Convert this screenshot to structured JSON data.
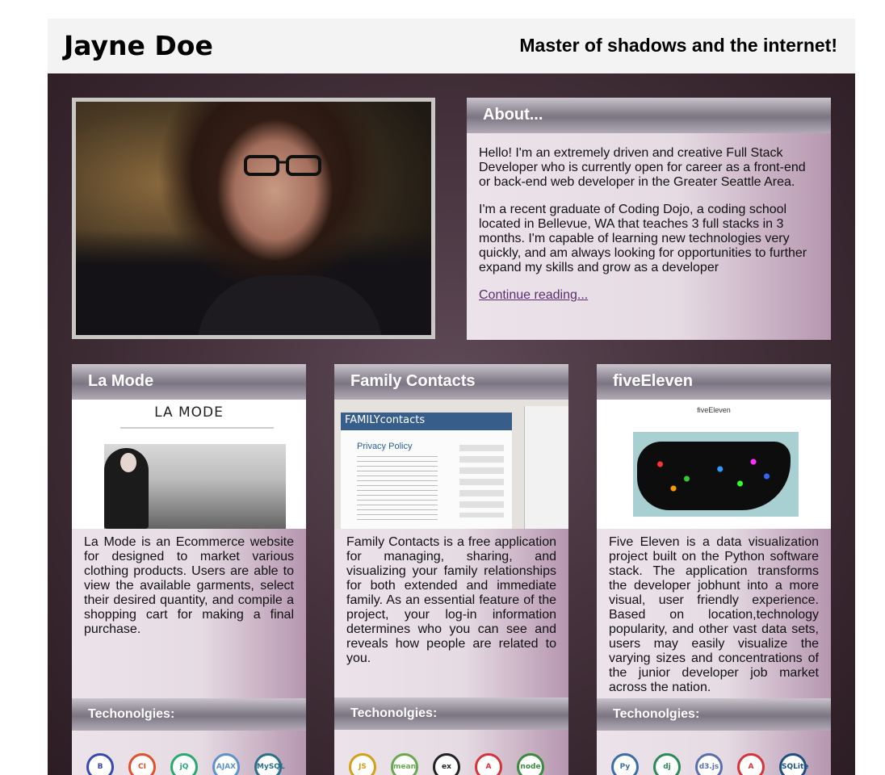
{
  "header": {
    "brand": "Jayne Doe",
    "tagline": "Master of shadows and the internet!"
  },
  "about": {
    "title": "About...",
    "paragraphs": [
      "Hello! I'm an extremely driven and creative Full Stack Developer who is currently open for career as a front-end or back-end web developer in the Greater Seattle Area.",
      "I'm a recent graduate of Coding Dojo, a coding school located in Bellevue, WA that teaches 3 full stacks in 3 months. I'm capable of learning new technologies very quickly, and am always looking for opportunities to further expand my skills and grow as a developer"
    ],
    "link": "Continue reading..."
  },
  "projects": [
    {
      "title": "La Mode",
      "thumb_text": "LA MODE",
      "description": "La Mode is an Ecommerce website for designed to market various clothing products. Users are able to view the available garments, select their desired quantity, and compile a shopping cart for making a final purchase.",
      "tech_title": "Techonolgies:",
      "tech": [
        {
          "icon": "bootstrap-icon",
          "label": "B",
          "color": "#3949ab"
        },
        {
          "icon": "codeigniter-icon",
          "label": "CI",
          "color": "#e0512c"
        },
        {
          "icon": "jquery-icon",
          "label": "jQ",
          "color": "#2aa872"
        },
        {
          "icon": "ajax-icon",
          "label": "AJAX",
          "color": "#5f93c8"
        },
        {
          "icon": "mysql-icon",
          "label": "MySQL",
          "color": "#2b6f8a"
        }
      ]
    },
    {
      "title": "Family Contacts",
      "thumb_text": "FAMILYcontacts",
      "thumb_subtext": "Privacy Policy",
      "description": "Family Contacts is a free application for managing, sharing, and visualizing your family relationships for both extended and immediate family. As an essential feature of the project, your log-in information determines who you can see and reveals how people are related to you.",
      "tech_title": "Techonolgies:",
      "tech": [
        {
          "icon": "javascript-icon",
          "label": "JS",
          "color": "#d4a017"
        },
        {
          "icon": "mean-icon",
          "label": "mean",
          "color": "#6aa84f"
        },
        {
          "icon": "express-icon",
          "label": "ex",
          "color": "#222222"
        },
        {
          "icon": "angular-icon",
          "label": "A",
          "color": "#d6333a"
        },
        {
          "icon": "node-icon",
          "label": "node",
          "color": "#3c8a3e"
        }
      ]
    },
    {
      "title": "fiveEleven",
      "thumb_text": "fiveEleven",
      "description": "Five Eleven is a data visualization project built on the Python software stack. The application transforms the developer jobhunt into a more visual, user friendly experience. Based on location,technology popularity, and other vast data sets, users may easily visualize the varying sizes and concentrations of the junior developer job market across the nation.",
      "tech_title": "Techonolgies:",
      "tech": [
        {
          "icon": "python-icon",
          "label": "Py",
          "color": "#3a6ea5"
        },
        {
          "icon": "django-icon",
          "label": "dj",
          "color": "#2b8a57"
        },
        {
          "icon": "d3-icon",
          "label": "d3.js",
          "color": "#5a6fb0"
        },
        {
          "icon": "angular-icon",
          "label": "A",
          "color": "#d6333a"
        },
        {
          "icon": "sqlite-icon",
          "label": "SQLite",
          "color": "#1e4f80"
        }
      ]
    }
  ]
}
